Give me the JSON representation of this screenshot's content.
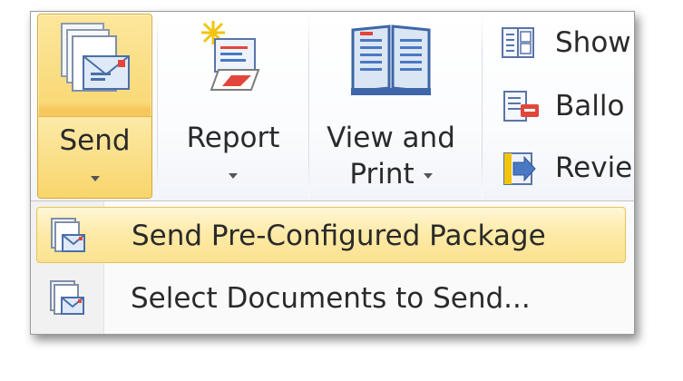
{
  "ribbon": {
    "send": {
      "label": "Send",
      "icon": "send-package-icon"
    },
    "report": {
      "label": "Report",
      "icon": "report-icon"
    },
    "view_print": {
      "label_line1": "View and",
      "label_line2": "Print",
      "icon": "book-icon"
    },
    "small_items": [
      {
        "label": "Show",
        "icon": "show-pages-icon"
      },
      {
        "label": "Ballo",
        "icon": "balloon-icon"
      },
      {
        "label": "Revie",
        "icon": "review-icon"
      }
    ]
  },
  "menu": {
    "items": [
      {
        "label": "Send Pre-Configured Package",
        "icon": "package-icon",
        "highlighted": true
      },
      {
        "label": "Select Documents to Send...",
        "icon": "documents-icon",
        "highlighted": false
      }
    ]
  },
  "colors": {
    "highlight": "#fbe291",
    "highlight_border": "#e8c35a",
    "accent_red": "#e2463a",
    "icon_blue": "#4a78c2"
  }
}
